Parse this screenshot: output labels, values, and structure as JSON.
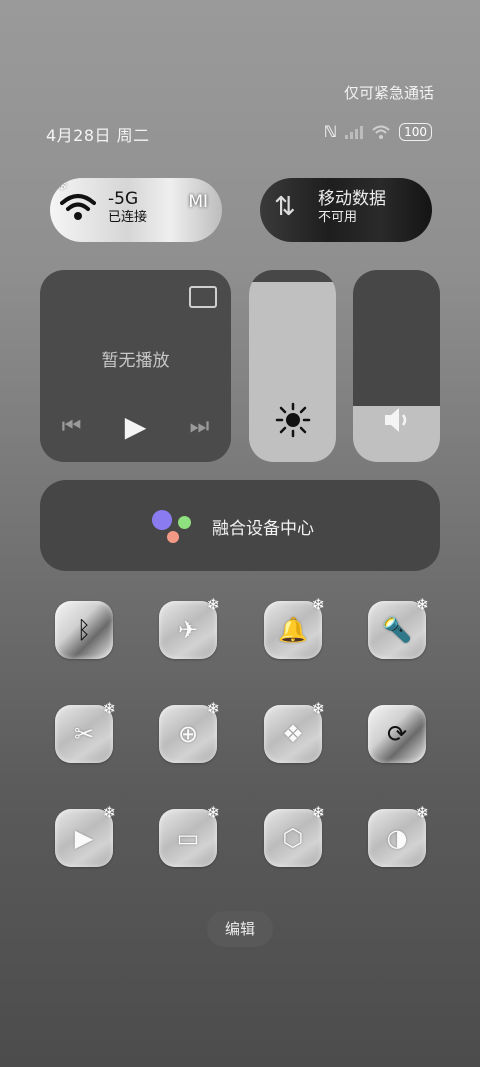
{
  "status_bar": {
    "emergency_text": "仅可紧急通话",
    "date_text": "4月28日 周二",
    "nfc_icon": "nfc-icon",
    "battery_level": "100"
  },
  "wifi_tile": {
    "ssid": "-5G",
    "ssid_tail": "MI",
    "status": "已连接"
  },
  "mobile_tile": {
    "label": "移动数据",
    "status": "不可用"
  },
  "media": {
    "title": "暂无播放",
    "prev_glyph": "⏮",
    "play_glyph": "▶",
    "next_glyph": "⏭"
  },
  "brightness": {
    "level": 0.94,
    "icon": "sun-icon"
  },
  "volume": {
    "level": 0.29,
    "icon": "speaker-icon"
  },
  "device_center": {
    "label": "融合设备中心"
  },
  "toggles": [
    {
      "name": "bluetooth-toggle",
      "icon": "bluetooth-icon",
      "glyph": "ᛒ"
    },
    {
      "name": "airplane-toggle",
      "icon": "airplane-icon",
      "glyph": "✈"
    },
    {
      "name": "mute-toggle",
      "icon": "bell-icon",
      "glyph": "🔔"
    },
    {
      "name": "flashlight-toggle",
      "icon": "flashlight-icon",
      "glyph": "🔦"
    },
    {
      "name": "screenshot-toggle",
      "icon": "scissors-icon",
      "glyph": "✂"
    },
    {
      "name": "battery-saver-toggle",
      "icon": "battery-plus-icon",
      "glyph": "⊕"
    },
    {
      "name": "nearby-share-toggle",
      "icon": "share-diamond-icon",
      "glyph": "❖"
    },
    {
      "name": "rotation-lock-toggle",
      "icon": "rotation-lock-icon",
      "glyph": "⟳"
    },
    {
      "name": "screen-record-toggle",
      "icon": "video-camera-icon",
      "glyph": "▶"
    },
    {
      "name": "cast-toggle",
      "icon": "screen-cast-icon",
      "glyph": "▭"
    },
    {
      "name": "settings-toggle",
      "icon": "hexagon-icon",
      "glyph": "⬡"
    },
    {
      "name": "dark-mode-toggle",
      "icon": "contrast-icon",
      "glyph": "◑"
    }
  ],
  "edit_button": {
    "label": "编辑"
  },
  "colors": {
    "tile_bg": "#4b4b4b",
    "slider_fill": "#c0c0c0"
  }
}
